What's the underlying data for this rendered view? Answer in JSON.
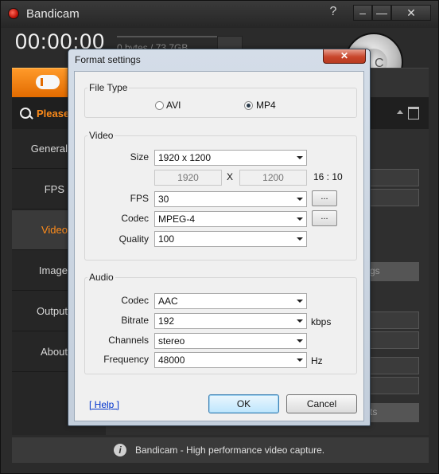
{
  "app": {
    "title": "Bandicam",
    "help_glyph": "?",
    "minimize_glyph": "–",
    "minimize2_glyph": "—",
    "close_glyph": "✕",
    "timer": "00:00:00",
    "bytes": "0 bytes / 73.7GB",
    "rec_letter": "C",
    "search_placeholder": "Please e",
    "status_text": "Bandicam - High performance video capture.",
    "info_glyph": "i"
  },
  "sidebar": {
    "items": [
      {
        "label": "General",
        "active": false
      },
      {
        "label": "FPS",
        "active": false
      },
      {
        "label": "Video",
        "active": true
      },
      {
        "label": "Image",
        "active": false
      },
      {
        "label": "Output",
        "active": false
      },
      {
        "label": "About",
        "active": false
      }
    ]
  },
  "background_buttons": {
    "settings_label": "gs",
    "presets_label": "ts"
  },
  "dialog": {
    "title": "Format settings",
    "close_glyph": "✕",
    "file_type": {
      "group_title": "File Type",
      "options": [
        "AVI",
        "MP4"
      ],
      "selected": "MP4"
    },
    "video": {
      "group_title": "Video",
      "size_label": "Size",
      "size_value": "1920 x 1200",
      "width": "1920",
      "x_sep": "X",
      "height": "1200",
      "ratio": "16 : 10",
      "fps_label": "FPS",
      "fps_value": "30",
      "codec_label": "Codec",
      "codec_value": "MPEG-4",
      "quality_label": "Quality",
      "quality_value": "100",
      "dots": "..."
    },
    "audio": {
      "group_title": "Audio",
      "codec_label": "Codec",
      "codec_value": "AAC",
      "bitrate_label": "Bitrate",
      "bitrate_value": "192",
      "bitrate_unit": "kbps",
      "channels_label": "Channels",
      "channels_value": "stereo",
      "frequency_label": "Frequency",
      "frequency_value": "48000",
      "frequency_unit": "Hz"
    },
    "help_label": "[ Help ]",
    "ok_label": "OK",
    "cancel_label": "Cancel"
  },
  "colors": {
    "accent": "#ff8c1a",
    "dialog_bg": "#f0f0f0",
    "app_bg": "#2b2b2b"
  }
}
